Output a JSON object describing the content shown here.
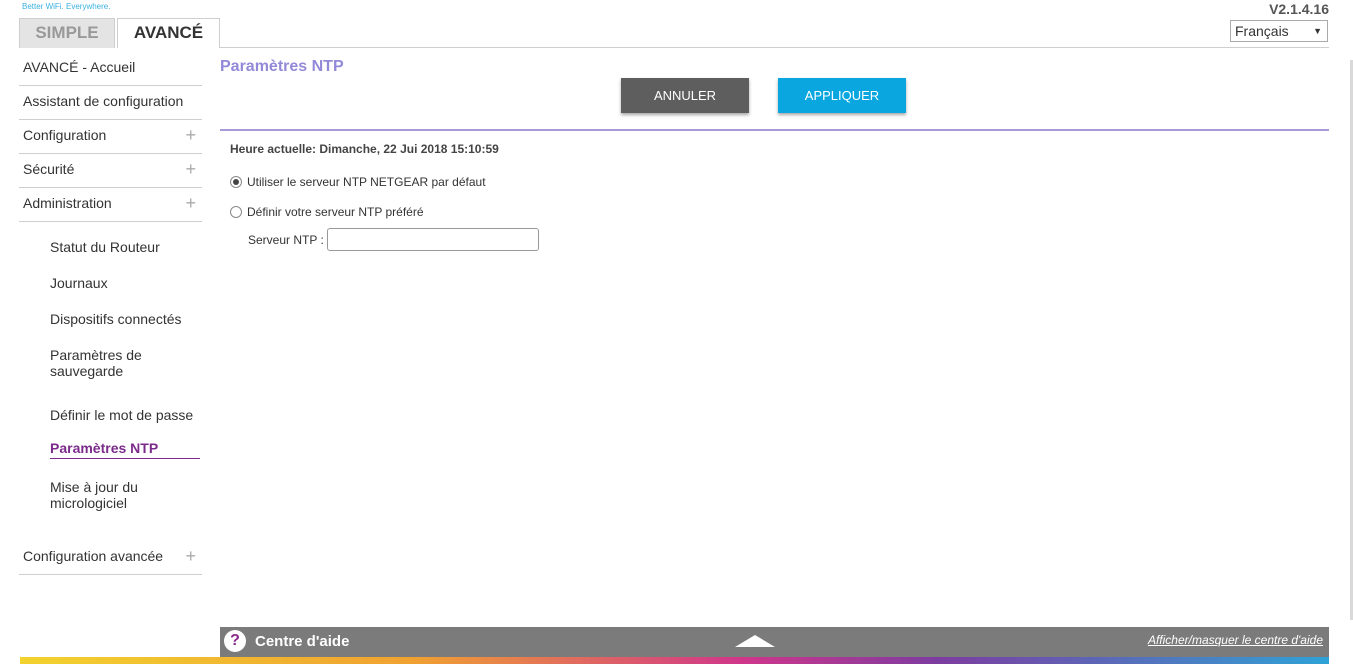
{
  "header": {
    "tagline": "Better WiFi. Everywhere.",
    "version": "V2.1.4.16",
    "language": "Français",
    "tabs": [
      {
        "label": "SIMPLE",
        "active": false
      },
      {
        "label": "AVANCÉ",
        "active": true
      }
    ]
  },
  "sidebar": {
    "items": [
      {
        "label": "AVANCÉ - Accueil",
        "expandable": false
      },
      {
        "label": "Assistant de configuration",
        "expandable": false
      },
      {
        "label": "Configuration",
        "expandable": true
      },
      {
        "label": "Sécurité",
        "expandable": true
      },
      {
        "label": "Administration",
        "expandable": true
      }
    ],
    "admin_subitems": [
      {
        "label": "Statut du Routeur"
      },
      {
        "label": "Journaux"
      },
      {
        "label": "Dispositifs connectés"
      },
      {
        "label": "Paramètres de sauvegarde"
      },
      {
        "label": "Définir le mot de passe"
      },
      {
        "label": "Paramètres NTP",
        "active": true
      },
      {
        "label": "Mise à jour du micrologiciel"
      }
    ],
    "advanced_item": {
      "label": "Configuration avancée",
      "expandable": true
    },
    "plus_symbol": "+"
  },
  "main": {
    "title": "Paramètres NTP",
    "cancel_label": "ANNULER",
    "apply_label": "APPLIQUER",
    "current_time": "Heure actuelle: Dimanche, 22 Jui 2018 15:10:59",
    "options": [
      {
        "label": "Utiliser le serveur NTP NETGEAR par défaut",
        "checked": true
      },
      {
        "label": "Définir votre serveur NTP préféré",
        "checked": false
      }
    ],
    "ntp_server_label": "Serveur NTP :",
    "ntp_server_value": ""
  },
  "help": {
    "icon_glyph": "?",
    "title": "Centre d'aide",
    "toggle_link": "Afficher/masquer le centre d'aide"
  },
  "colors": {
    "accent": "#9289d9",
    "active_menu": "#7b2a8b",
    "apply_button": "#09a6df",
    "cancel_button": "#5e5e5e"
  }
}
